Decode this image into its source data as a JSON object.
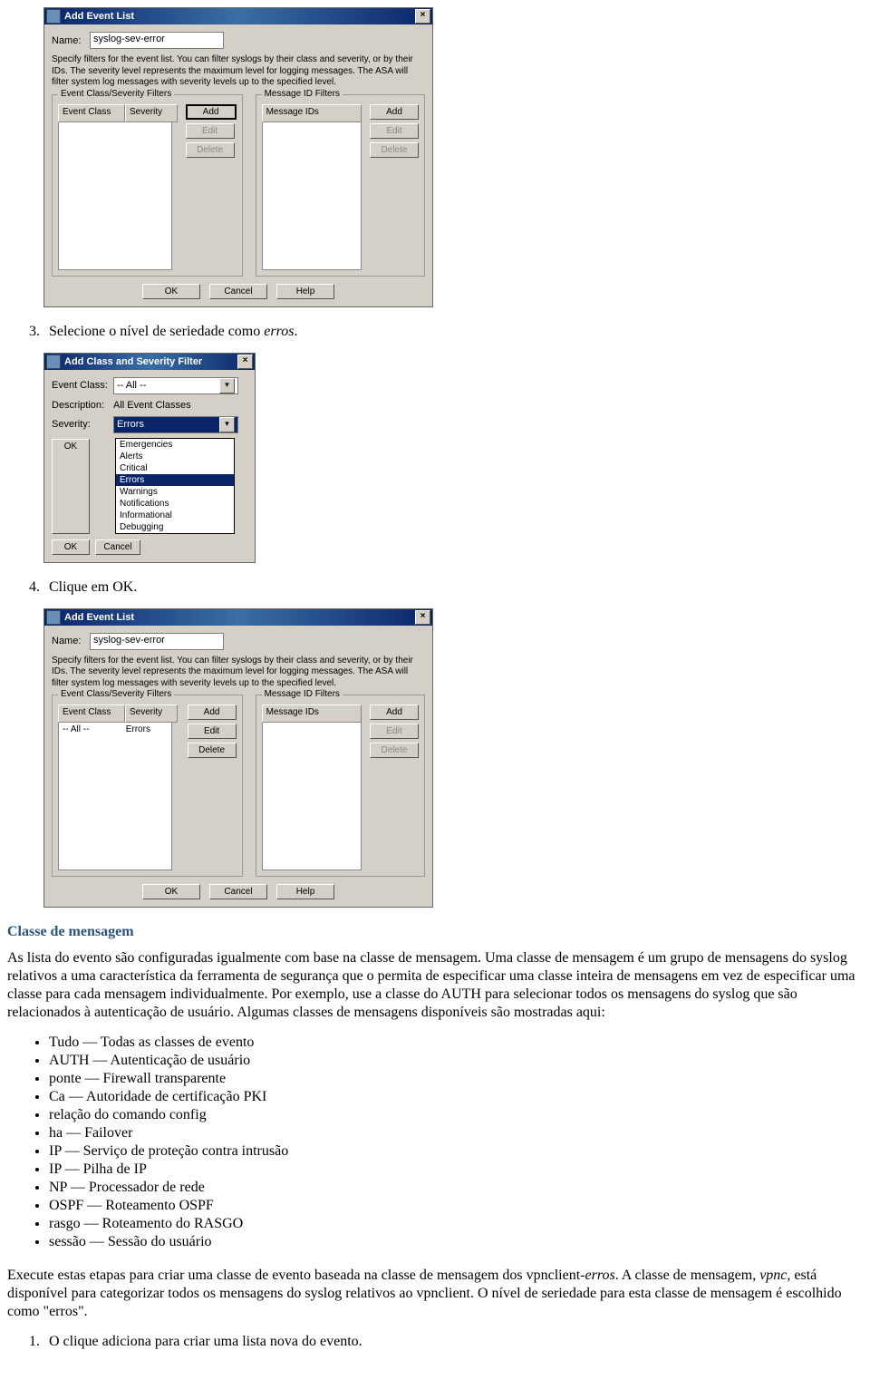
{
  "dlg1": {
    "title": "Add Event List",
    "name_label": "Name:",
    "name_value": "syslog-sev-error",
    "desc": "Specify filters for the event list. You can filter syslogs by their class and severity, or by their IDs. The severity level represents the maximum level for logging messages. The ASA will filter system log messages with severity levels up to the specified level.",
    "group1_label": "Event Class/Severity Filters",
    "th_eventclass": "Event Class",
    "th_severity": "Severity",
    "group2_label": "Message ID Filters",
    "th_msgids": "Message IDs",
    "btn_add": "Add",
    "btn_edit": "Edit",
    "btn_delete": "Delete",
    "btn_ok": "OK",
    "btn_cancel": "Cancel",
    "btn_help": "Help"
  },
  "step3": {
    "num": "3.",
    "text_a": "Selecione o nível de seriedade como ",
    "text_em": "erros",
    "text_b": "."
  },
  "dlg2": {
    "title": "Add Class and Severity Filter",
    "l_eventclass": "Event Class:",
    "v_eventclass": "-- All --",
    "l_desc": "Description:",
    "v_desc": "All Event Classes",
    "l_severity": "Severity:",
    "v_severity": "Errors",
    "dd": [
      "Emergencies",
      "Alerts",
      "Critical",
      "Errors",
      "Warnings",
      "Notifications",
      "Informational",
      "Debugging"
    ],
    "btn_ok": "OK",
    "btn_cancel": "Cancel"
  },
  "step4": {
    "num": "4.",
    "text": "Clique em OK."
  },
  "dlg3": {
    "title": "Add Event List",
    "name_label": "Name:",
    "name_value": "syslog-sev-error",
    "desc": "Specify filters for the event list. You can filter syslogs by their class and severity, or by their IDs. The severity level represents the maximum level for logging messages. The ASA will filter system log messages with severity levels up to the specified level.",
    "group1_label": "Event Class/Severity Filters",
    "th_eventclass": "Event Class",
    "th_severity": "Severity",
    "row_ec": "-- All --",
    "row_sev": "Errors",
    "group2_label": "Message ID Filters",
    "th_msgids": "Message IDs",
    "btn_add": "Add",
    "btn_edit": "Edit",
    "btn_delete": "Delete",
    "btn_ok": "OK",
    "btn_cancel": "Cancel",
    "btn_help": "Help"
  },
  "section_title": "Classe de mensagem",
  "para1": "As lista do evento são configuradas igualmente com base na classe de mensagem. Uma classe de mensagem é um grupo de mensagens do syslog relativos a uma característica da ferramenta de segurança que o permita de especificar uma classe inteira de mensagens em vez de especificar uma classe para cada mensagem individualmente. Por exemplo, use a classe do AUTH para selecionar todos os mensagens do syslog que são relacionados à autenticação de usuário. Algumas classes de mensagens disponíveis são mostradas aqui:",
  "bullets": [
    "Tudo — Todas as classes de evento",
    "AUTH — Autenticação de usuário",
    "ponte — Firewall transparente",
    "Ca — Autoridade de certificação PKI",
    "relação do comando config",
    "ha — Failover",
    "IP — Serviço de proteção contra intrusão",
    "IP — Pilha de IP",
    "NP — Processador de rede",
    "OSPF — Roteamento OSPF",
    "rasgo — Roteamento do RASGO",
    "sessão — Sessão do usuário"
  ],
  "para2a": "Execute estas etapas para criar uma classe de evento baseada na classe de mensagem dos vpnclient-",
  "para2em": "erros",
  "para2b": ". A classe de mensagem, ",
  "para2em2": "vpnc",
  "para2c": ", está disponível para categorizar todos os mensagens do syslog relativos ao vpnclient. O nível de seriedade para esta classe de mensagem é escolhido como \"erros\".",
  "step_last": {
    "num": "1.",
    "text": "O clique adiciona para criar uma lista nova do evento."
  }
}
